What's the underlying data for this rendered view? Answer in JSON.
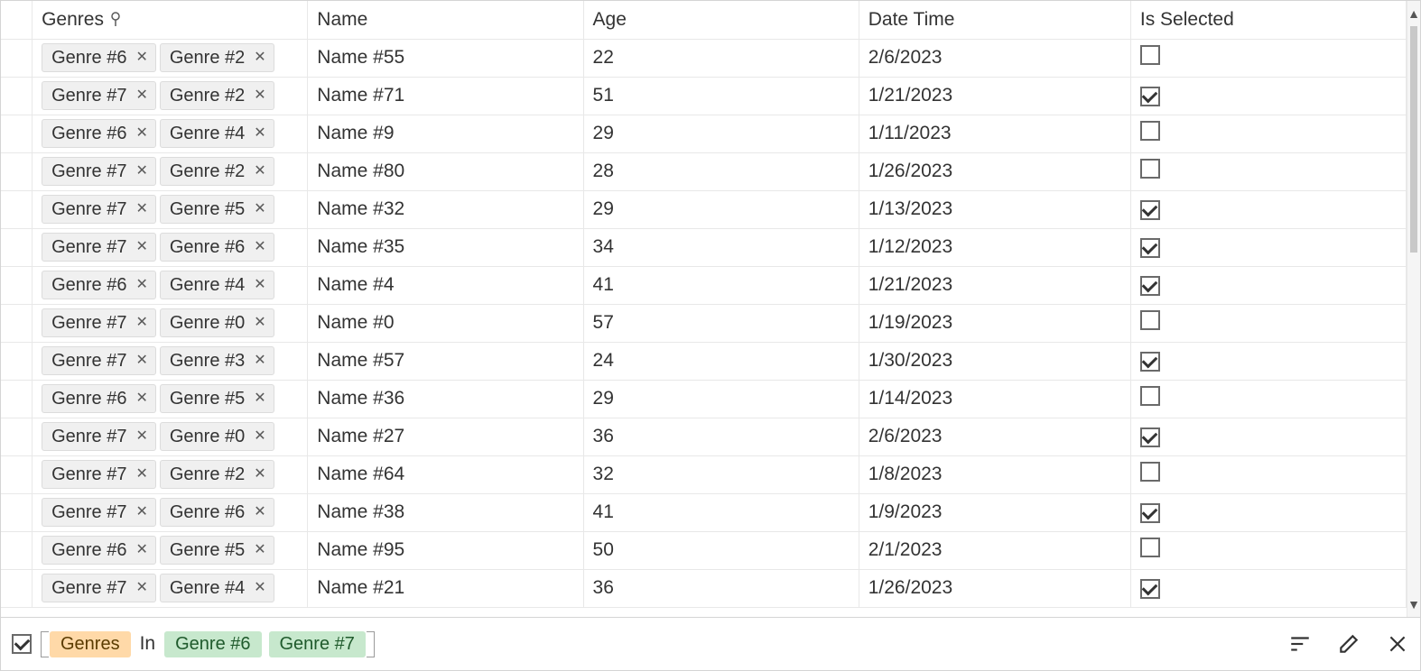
{
  "columns": {
    "genres": "Genres",
    "name": "Name",
    "age": "Age",
    "date": "Date Time",
    "selected": "Is Selected"
  },
  "rows": [
    {
      "g1": "Genre #6",
      "g2": "Genre #2",
      "name": "Name #55",
      "age": "22",
      "date": "2/6/2023",
      "sel": false
    },
    {
      "g1": "Genre #7",
      "g2": "Genre #2",
      "name": "Name #71",
      "age": "51",
      "date": "1/21/2023",
      "sel": true
    },
    {
      "g1": "Genre #6",
      "g2": "Genre #4",
      "name": "Name #9",
      "age": "29",
      "date": "1/11/2023",
      "sel": false
    },
    {
      "g1": "Genre #7",
      "g2": "Genre #2",
      "name": "Name #80",
      "age": "28",
      "date": "1/26/2023",
      "sel": false
    },
    {
      "g1": "Genre #7",
      "g2": "Genre #5",
      "name": "Name #32",
      "age": "29",
      "date": "1/13/2023",
      "sel": true
    },
    {
      "g1": "Genre #7",
      "g2": "Genre #6",
      "name": "Name #35",
      "age": "34",
      "date": "1/12/2023",
      "sel": true
    },
    {
      "g1": "Genre #6",
      "g2": "Genre #4",
      "name": "Name #4",
      "age": "41",
      "date": "1/21/2023",
      "sel": true
    },
    {
      "g1": "Genre #7",
      "g2": "Genre #0",
      "name": "Name #0",
      "age": "57",
      "date": "1/19/2023",
      "sel": false
    },
    {
      "g1": "Genre #7",
      "g2": "Genre #3",
      "name": "Name #57",
      "age": "24",
      "date": "1/30/2023",
      "sel": true
    },
    {
      "g1": "Genre #6",
      "g2": "Genre #5",
      "name": "Name #36",
      "age": "29",
      "date": "1/14/2023",
      "sel": false
    },
    {
      "g1": "Genre #7",
      "g2": "Genre #0",
      "name": "Name #27",
      "age": "36",
      "date": "2/6/2023",
      "sel": true
    },
    {
      "g1": "Genre #7",
      "g2": "Genre #2",
      "name": "Name #64",
      "age": "32",
      "date": "1/8/2023",
      "sel": false
    },
    {
      "g1": "Genre #7",
      "g2": "Genre #6",
      "name": "Name #38",
      "age": "41",
      "date": "1/9/2023",
      "sel": true
    },
    {
      "g1": "Genre #6",
      "g2": "Genre #5",
      "name": "Name #95",
      "age": "50",
      "date": "2/1/2023",
      "sel": false
    },
    {
      "g1": "Genre #7",
      "g2": "Genre #4",
      "name": "Name #21",
      "age": "36",
      "date": "1/26/2023",
      "sel": true
    }
  ],
  "filter": {
    "enabled": true,
    "field": "Genres",
    "operator": "In",
    "values": [
      "Genre #6",
      "Genre #7"
    ]
  }
}
